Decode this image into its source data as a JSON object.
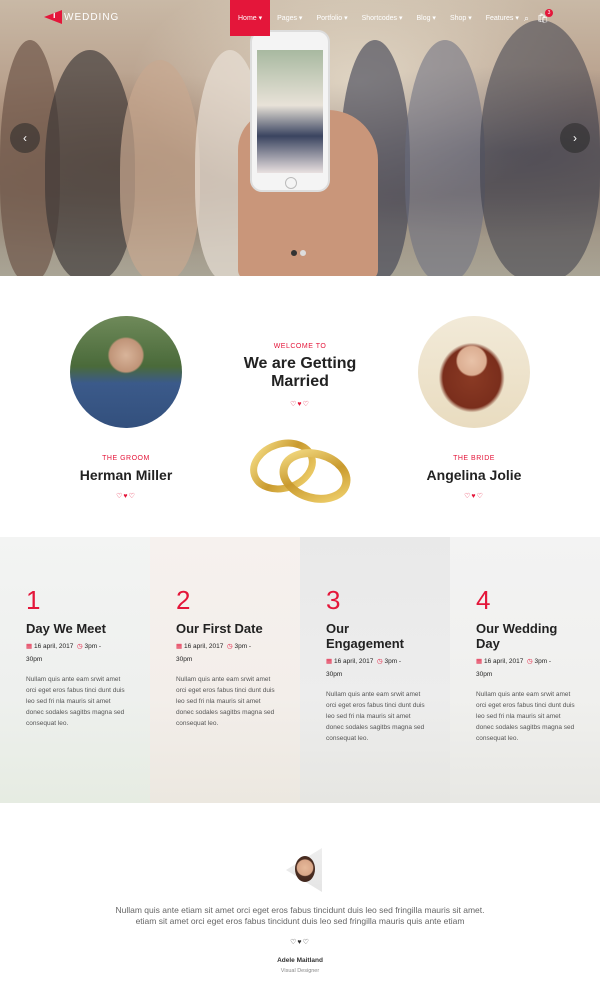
{
  "brand": {
    "mark": "i",
    "name": "WEDDING",
    "accent": "#e4163a"
  },
  "nav": {
    "items": [
      "Home ▾",
      "Pages ▾",
      "Portfolio ▾",
      "Shortcodes ▾",
      "Blog ▾",
      "Shop ▾",
      "Features ▾"
    ],
    "active_index": 0,
    "cart_count": "3"
  },
  "hero": {
    "prev_icon": "chevron-left-icon",
    "next_icon": "chevron-right-icon",
    "slide_count": 2,
    "active_slide": 0
  },
  "welcome": {
    "kicker": "WELCOME TO",
    "title_line1": "We are Getting",
    "title_line2": "Married",
    "hearts": "♡♥♡"
  },
  "groom": {
    "role": "THE GROOM",
    "name": "Herman Miller",
    "hearts": "♡♥♡"
  },
  "bride": {
    "role": "THE BRIDE",
    "name": "Angelina Jolie",
    "hearts": "♡♥♡"
  },
  "timeline": [
    {
      "num": "1",
      "title": "Day We Meet",
      "date": "16 april, 2017",
      "time": "3pm -",
      "time2": "30pm",
      "text": "Nullam quis ante eam srwit amet orci eget eros fabus tinci dunt duis leo sed fri nla mauris sit amet donec sodales sagitbs magna sed consequat leo."
    },
    {
      "num": "2",
      "title": "Our First Date",
      "date": "16 april, 2017",
      "time": "3pm -",
      "time2": "30pm",
      "text": "Nullam quis ante eam srwit amet orci eget eros fabus tinci dunt duis leo sed fri nla mauris sit amet donec sodales sagitbs magna sed consequat leo."
    },
    {
      "num": "3",
      "title": "Our Engagement",
      "date": "16 april, 2017",
      "time": "3pm -",
      "time2": "30pm",
      "text": "Nullam quis ante eam srwit amet orci eget eros fabus tinci dunt duis leo sed fri nla mauris sit amet donec sodales sagitbs magna sed consequat leo."
    },
    {
      "num": "4",
      "title": "Our Wedding Day",
      "date": "16 april, 2017",
      "time": "3pm -",
      "time2": "30pm",
      "text": "Nullam quis ante eam srwit amet orci eget eros fabus tinci dunt duis leo sed fri nla mauris sit amet donec sodales sagitbs magna sed consequat leo."
    }
  ],
  "testimonial": {
    "quote_line1": "Nullam quis ante etiam sit amet orci eget eros fabus tincidunt duis leo sed fringilla mauris sit amet.",
    "quote_line2": "etiam sit amet orci eget eros fabus tincidunt duis leo sed fringilla mauris quis ante etiam",
    "hearts": "♡♥♡",
    "author": "Adele Maitland",
    "role": "Visual Designer"
  }
}
